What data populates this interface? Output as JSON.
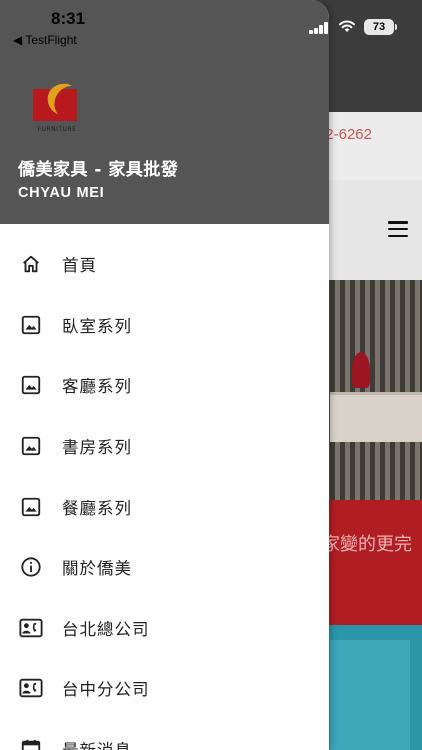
{
  "status_bar": {
    "time": "8:31",
    "back_app": "◀ TestFlight",
    "battery": "73"
  },
  "background_page": {
    "phone_partial": "2-6262",
    "banner_partial": "家變的更完"
  },
  "drawer": {
    "logo_text": "FURNITURE",
    "title": "僑美家具 - 家具批發",
    "subtitle": "CHYAU MEI",
    "items": [
      {
        "label": "首頁",
        "icon": "home-icon"
      },
      {
        "label": "臥室系列",
        "icon": "image-icon"
      },
      {
        "label": "客廳系列",
        "icon": "image-icon"
      },
      {
        "label": "書房系列",
        "icon": "image-icon"
      },
      {
        "label": "餐廳系列",
        "icon": "image-icon"
      },
      {
        "label": "關於僑美",
        "icon": "info-icon"
      },
      {
        "label": "台北總公司",
        "icon": "contact-phone-icon"
      },
      {
        "label": "台中分公司",
        "icon": "contact-phone-icon"
      },
      {
        "label": "最新消息",
        "icon": "calendar-icon"
      }
    ]
  },
  "colors": {
    "header_bg": "#555555",
    "logo_red": "#b8191f",
    "logo_gold": "#e0a020"
  }
}
